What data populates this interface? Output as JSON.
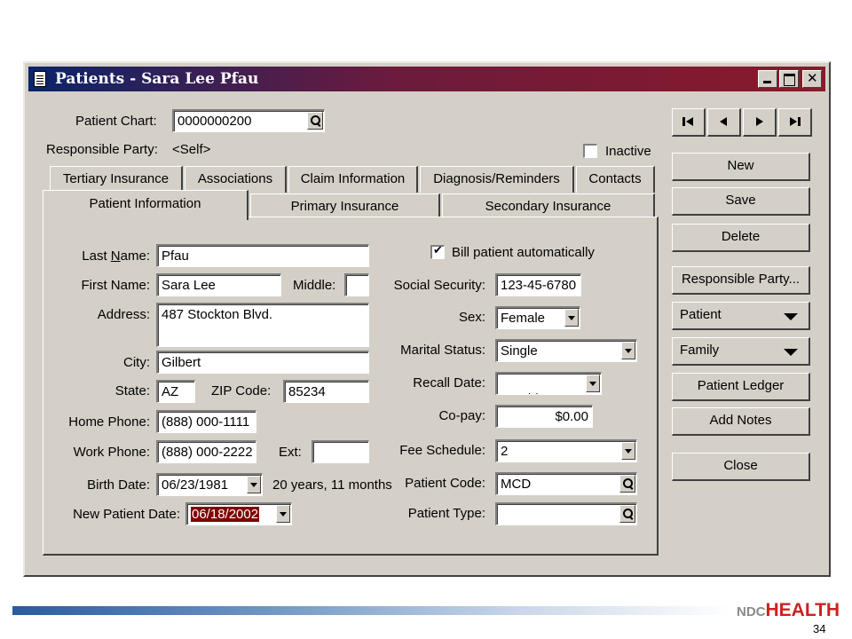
{
  "window": {
    "title": "Patients - Sara Lee Pfau"
  },
  "header": {
    "patient_chart_label": "Patient Chart:",
    "patient_chart_value": "0000000200",
    "responsible_party_label": "Responsible Party:",
    "responsible_party_value": "<Self>",
    "inactive_label": "Inactive",
    "inactive_checked": false
  },
  "tabs": {
    "back": [
      "Tertiary Insurance",
      "Associations",
      "Claim Information",
      "Diagnosis/Reminders",
      "Contacts"
    ],
    "front": [
      "Patient Information",
      "Primary Insurance",
      "Secondary Insurance"
    ],
    "active": "Patient Information"
  },
  "form": {
    "last_name_label": "Last Name:",
    "last_name": "Pfau",
    "first_name_label": "First Name:",
    "first_name": "Sara Lee",
    "middle_label": "Middle:",
    "middle": "",
    "address_label": "Address:",
    "address": "487 Stockton Blvd.",
    "city_label": "City:",
    "city": "Gilbert",
    "state_label": "State:",
    "state": "AZ",
    "zip_label": "ZIP Code:",
    "zip": "85234",
    "home_phone_label": "Home Phone:",
    "home_phone": "(888) 000-1111",
    "work_phone_label": "Work Phone:",
    "work_phone": "(888) 000-2222",
    "ext_label": "Ext:",
    "ext": "",
    "birth_date_label": "Birth Date:",
    "birth_date": "06/23/1981",
    "age_text": "20 years, 11 months",
    "new_patient_date_label": "New Patient Date:",
    "new_patient_date": "06/18/2002",
    "bill_auto_label": "Bill patient automatically",
    "bill_auto_checked": true,
    "ssn_label": "Social Security:",
    "ssn": "123-45-6780",
    "sex_label": "Sex:",
    "sex": "Female",
    "marital_label": "Marital Status:",
    "marital": "Single",
    "recall_label": "Recall Date:",
    "recall": " / /",
    "copay_label": "Co-pay:",
    "copay": "$0.00",
    "fee_label": "Fee Schedule:",
    "fee": "2",
    "patient_code_label": "Patient Code:",
    "patient_code": "MCD",
    "patient_type_label": "Patient Type:",
    "patient_type": ""
  },
  "buttons": {
    "new": "New",
    "save": "Save",
    "delete": "Delete",
    "responsible_party": "Responsible Party...",
    "patient": "Patient",
    "family": "Family",
    "patient_ledger": "Patient Ledger",
    "add_notes": "Add Notes",
    "close": "Close"
  },
  "footer": {
    "brand_prefix": "NDC",
    "brand_main": "HEALTH",
    "page_number": "34"
  },
  "colors": {
    "titlebar_start": "#0a246a",
    "titlebar_end": "#8a1a2a",
    "highlight_date_bg": "#800000"
  }
}
